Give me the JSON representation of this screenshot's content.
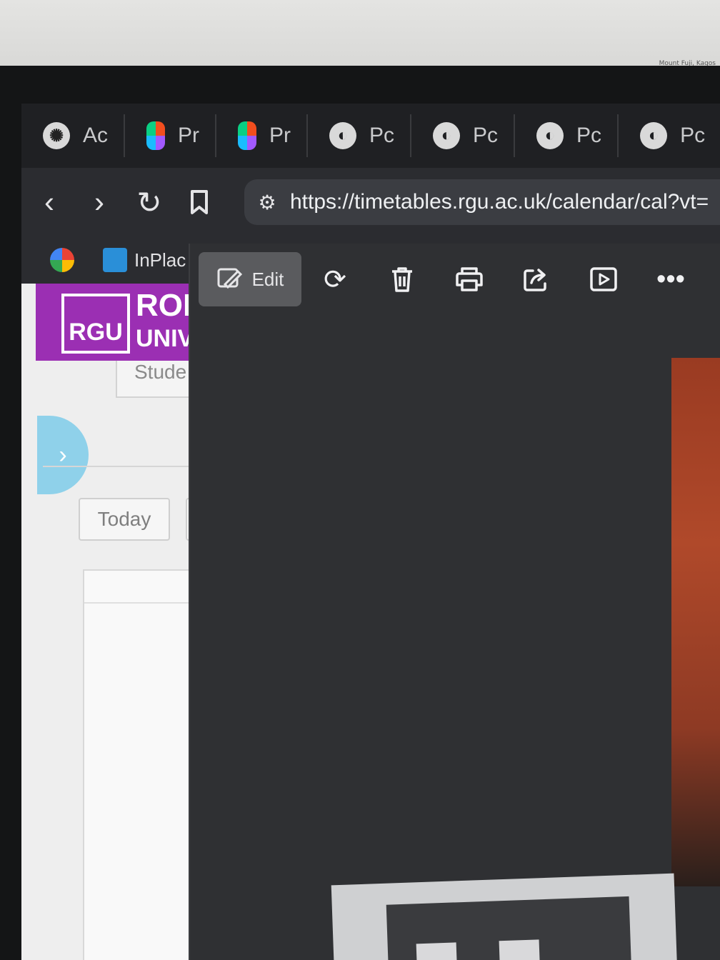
{
  "environment": {
    "sticker_text": "Mount Fuji, Kagos"
  },
  "tabs": [
    {
      "label": "Ac",
      "icon": "openai-icon"
    },
    {
      "label": "Pr",
      "icon": "figma-icon"
    },
    {
      "label": "Pr",
      "icon": "figma-icon"
    },
    {
      "label": "Pc",
      "icon": "globe-icon"
    },
    {
      "label": "Pc",
      "icon": "globe-icon"
    },
    {
      "label": "Pc",
      "icon": "globe-icon"
    },
    {
      "label": "Pc",
      "icon": "globe-icon"
    }
  ],
  "navbar": {
    "back": "‹",
    "forward": "›",
    "reload": "↻",
    "bookmark": "⌑",
    "url": "https://timetables.rgu.ac.uk/calendar/cal?vt="
  },
  "bookmarks": [
    {
      "label": "",
      "icon": "google-photos-icon"
    },
    {
      "label": "InPlac",
      "icon": "inplace-icon"
    }
  ],
  "page": {
    "logo_text": "RGU",
    "title_line1": "ROI",
    "title_line2": "UNIV",
    "student_box": "Stude",
    "collapse_glyph": "›",
    "today_label": "Today",
    "brand_color": "#9b2fb3"
  },
  "viewer": {
    "edit_label": "Edit",
    "tools": [
      "rotate-icon",
      "delete-icon",
      "print-icon",
      "share-icon",
      "slideshow-icon",
      "more-icon"
    ],
    "tool_glyphs": [
      "⟳",
      "🗑",
      "⎙",
      "⇪",
      "▷",
      "•••"
    ]
  }
}
